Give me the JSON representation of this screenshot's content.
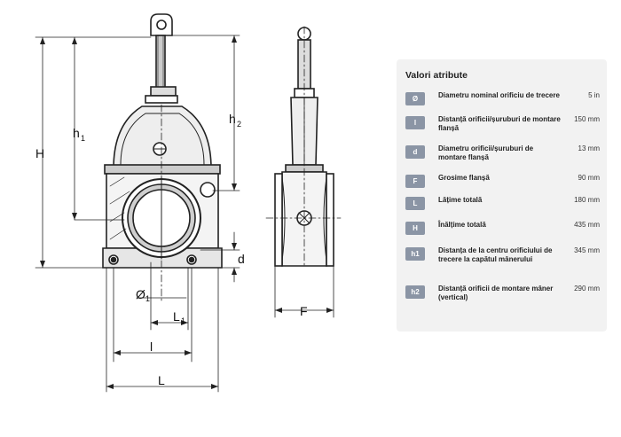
{
  "drawing": {
    "labels": {
      "H": "H",
      "h1": "h",
      "h1_sub": "1",
      "h2": "h",
      "h2_sub": "2",
      "d": "d",
      "phi": "Ø",
      "phi_sub": "1",
      "L1": "L",
      "L1_sub": "1",
      "l": "l",
      "L": "L",
      "F": "F"
    }
  },
  "panel": {
    "title": "Valori atribute",
    "rows": [
      {
        "badge": "Ø",
        "name": "Diametru nominal orificiu de trecere",
        "value": "5 in"
      },
      {
        "badge": "l",
        "name": "Distanță orificii/șuruburi de montare flanșă",
        "value": "150 mm"
      },
      {
        "badge": "d",
        "name": "Diametru orificii/șuruburi de montare flanșă",
        "value": "13 mm"
      },
      {
        "badge": "F",
        "name": "Grosime flanșă",
        "value": "90 mm"
      },
      {
        "badge": "L",
        "name": "Lățime totală",
        "value": "180 mm"
      },
      {
        "badge": "H",
        "name": "Înălțime totală",
        "value": "435 mm"
      },
      {
        "badge": "h1",
        "name": "Distanța de la centru orificiului de trecere la capătul mânerului",
        "value": "345 mm"
      },
      {
        "badge": "h2",
        "name": "Distanță orificii de montare mâner (vertical)",
        "value": "290 mm"
      }
    ]
  }
}
